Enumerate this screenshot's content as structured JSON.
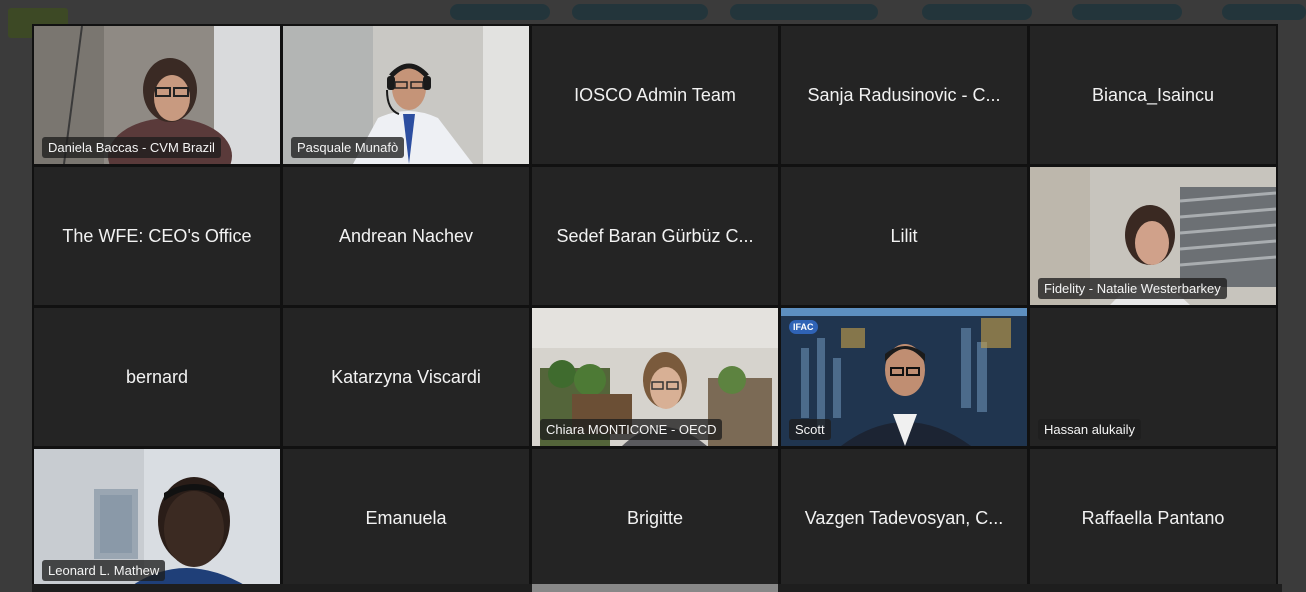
{
  "meeting": {
    "participants": [
      {
        "name": "Daniela Baccas - CVM Brazil",
        "video": true
      },
      {
        "name": "Pasquale Munafò",
        "video": true
      },
      {
        "name": "IOSCO Admin Team",
        "video": false
      },
      {
        "name": "Sanja Radusinovic - C...",
        "video": false
      },
      {
        "name": "Bianca_Isaincu",
        "video": false
      },
      {
        "name": "The WFE: CEO's Office",
        "video": false
      },
      {
        "name": "Andrean Nachev",
        "video": false
      },
      {
        "name": "Sedef Baran Gürbüz C...",
        "video": false
      },
      {
        "name": "Lilit",
        "video": false
      },
      {
        "name": "Fidelity - Natalie Westerbarkey",
        "video": true
      },
      {
        "name": "bernard",
        "video": false
      },
      {
        "name": "Katarzyna Viscardi",
        "video": false
      },
      {
        "name": "Chiara MONTICONE - OECD",
        "video": true
      },
      {
        "name": "Scott",
        "video": true
      },
      {
        "name": "Hassan alukaily",
        "video": true
      },
      {
        "name": "Leonard L. Mathew",
        "video": true
      },
      {
        "name": "Emanuela",
        "video": false
      },
      {
        "name": "Brigitte",
        "video": false
      },
      {
        "name": "Vazgen Tadevosyan, C...",
        "video": false
      },
      {
        "name": "Raffaella Pantano",
        "video": false
      }
    ],
    "ifac_badge": "IFAC"
  }
}
